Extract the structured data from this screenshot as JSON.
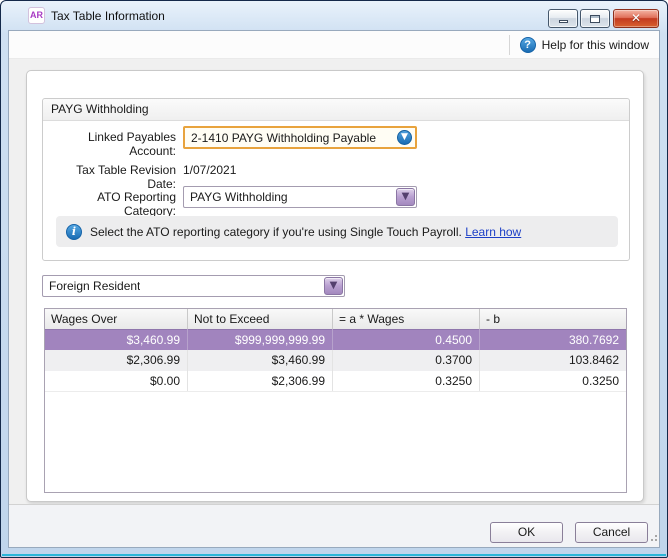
{
  "window": {
    "title": "Tax Table Information",
    "app_icon_text": "AR"
  },
  "toolbar": {
    "help_label": "Help for this window",
    "help_icon_glyph": "?"
  },
  "payg": {
    "group_title": "PAYG Withholding",
    "linked_account_label": "Linked Payables Account:",
    "linked_account_value": "2-1410 PAYG Withholding Payable",
    "revision_date_label": "Tax Table Revision Date:",
    "revision_date_value": "1/07/2021",
    "ato_category_label": "ATO Reporting Category:",
    "ato_category_value": "PAYG Withholding",
    "info_text": "Select the ATO reporting category if you're using Single Touch Payroll.",
    "info_link": "Learn how",
    "info_icon_glyph": "i"
  },
  "tax_scale": {
    "selected_value": "Foreign Resident"
  },
  "tax_table": {
    "columns": [
      "Wages Over",
      "Not to Exceed",
      "= a * Wages",
      "- b"
    ],
    "rows": [
      [
        "$3,460.99",
        "$999,999,999.99",
        "0.4500",
        "380.7692"
      ],
      [
        "$2,306.99",
        "$3,460.99",
        "0.3700",
        "103.8462"
      ],
      [
        "$0.00",
        "$2,306.99",
        "0.3250",
        "0.3250"
      ]
    ],
    "selected_row_index": 0
  },
  "buttons": {
    "ok": "OK",
    "cancel": "Cancel"
  },
  "glyphs": {
    "chevron_down": "▼",
    "close": "✕"
  },
  "colors": {
    "selected_row": "#a184be",
    "accent_orange": "#e8a33d",
    "link_blue": "#1c3fc7",
    "icon_blue": "#2d8dd6",
    "titlebar_blue": "#c0d5ec"
  }
}
